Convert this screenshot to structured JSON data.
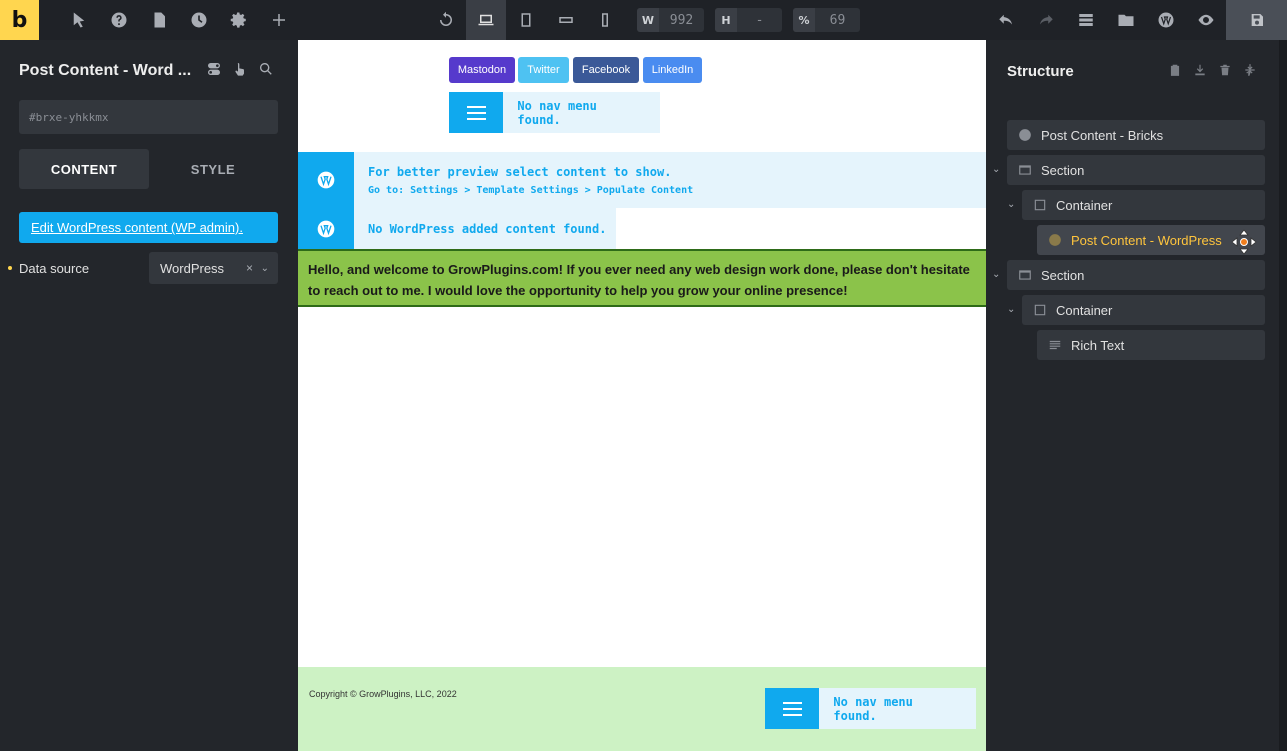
{
  "topbar": {
    "logo": "b",
    "width_label": "W",
    "width_value": "992",
    "height_label": "H",
    "height_value": "-",
    "zoom_label": "%",
    "zoom_value": "69"
  },
  "left_panel": {
    "title": "Post Content - Word  ...",
    "id_value": "#brxe-yhkkmx",
    "tabs": [
      {
        "label": "CONTENT"
      },
      {
        "label": "STYLE"
      }
    ],
    "edit_link": "Edit WordPress content (WP admin).",
    "data_source_label": "Data source",
    "data_source_value": "WordPress",
    "clear_glyph": "×",
    "chevron_glyph": "⌄"
  },
  "canvas": {
    "social_buttons": [
      {
        "label": "Mastodon",
        "color": "#563acc"
      },
      {
        "label": "Twitter",
        "color": "#4ec2f2"
      },
      {
        "label": "Facebook",
        "color": "#3b5998"
      },
      {
        "label": "LinkedIn",
        "color": "#4a8cf0"
      }
    ],
    "nav_message": "No nav menu found.",
    "notice_preview_line1": "For better preview select content to show.",
    "notice_preview_line2": "Go to: Settings > Template Settings > Populate Content",
    "notice_empty": "No WordPress added content found.",
    "rich_text": "Hello, and welcome to GrowPlugins.com! If you ever need any web design work done, please don't hesitate to reach out to me. I would love the opportunity to help you grow your online presence!",
    "footer_copyright": "Copyright © GrowPlugins, LLC, 2022",
    "footer_nav_message": "No nav menu found."
  },
  "right_panel": {
    "title": "Structure",
    "tree": [
      {
        "label": "Post Content - Bricks",
        "icon": "wordpress-icon"
      },
      {
        "label": "Section",
        "icon": "section-icon"
      },
      {
        "label": "Container",
        "icon": "container-icon"
      },
      {
        "label": "Post Content - WordPress",
        "icon": "wordpress-icon"
      },
      {
        "label": "Section",
        "icon": "section-icon"
      },
      {
        "label": "Container",
        "icon": "container-icon"
      },
      {
        "label": "Rich Text",
        "icon": "text-lines-icon"
      }
    ]
  },
  "colors": {
    "accent": "#ffd64f",
    "primary_blue": "#10a9ee",
    "selected_text": "#ffc53d",
    "rich_text_bg": "#8bc34a",
    "footer_bg": "#cdf2c4"
  }
}
